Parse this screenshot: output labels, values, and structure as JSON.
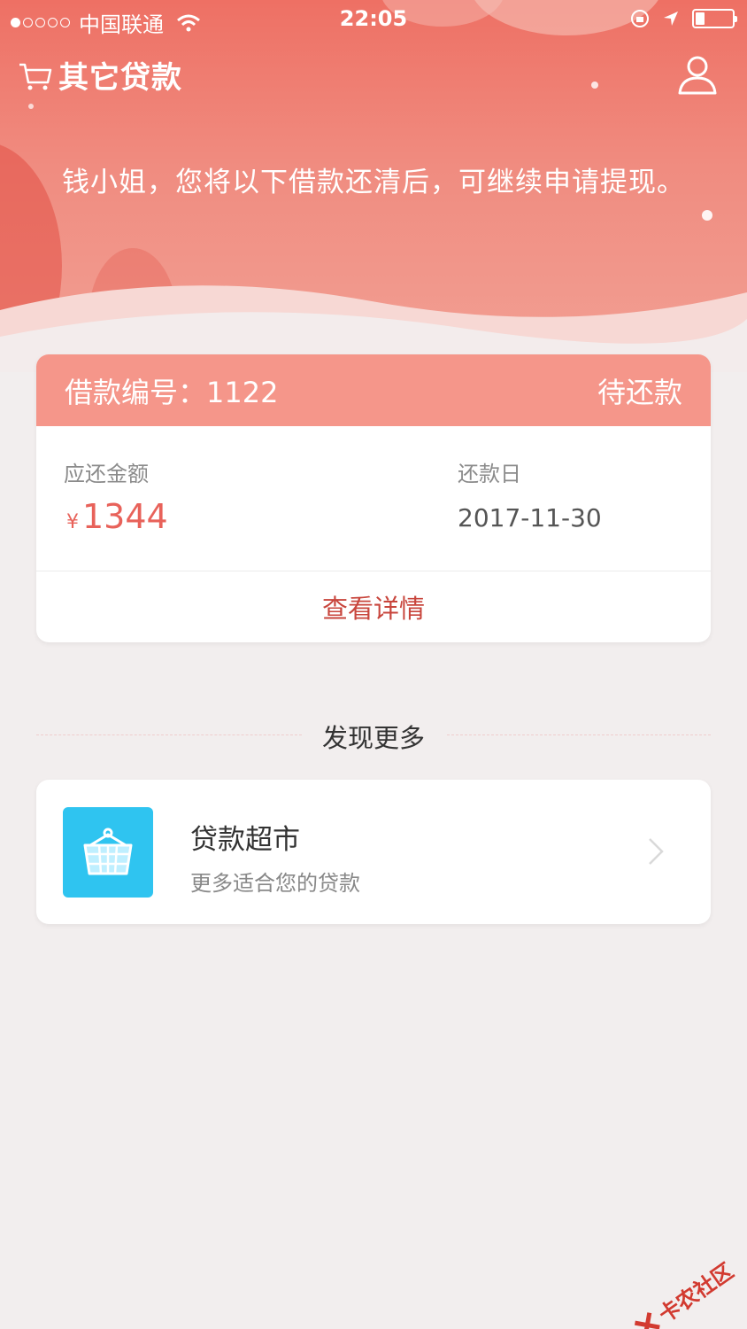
{
  "status_bar": {
    "carrier": "中国联通",
    "time": "22:05"
  },
  "header": {
    "title": "其它贷款",
    "message": "钱小姐，您将以下借款还清后，可继续申请提现。"
  },
  "loan_card": {
    "id_label": "借款编号：1122",
    "status": "待还款",
    "amount_label": "应还金额",
    "currency": "¥",
    "amount": "1344",
    "due_label": "还款日",
    "due_date": "2017-11-30",
    "detail_link": "查看详情"
  },
  "discover": {
    "title": "发现更多"
  },
  "market": {
    "title": "贷款超市",
    "subtitle": "更多适合您的贷款"
  },
  "watermark": "卡农社区",
  "colors": {
    "accent": "#f5968a",
    "amount": "#e8625a",
    "link": "#c8453c",
    "icon_bg": "#2fc4f0"
  }
}
